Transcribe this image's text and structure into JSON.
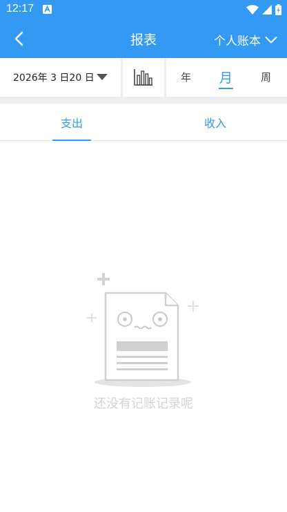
{
  "status_bar": {
    "time": "12:17"
  },
  "header": {
    "title": "报表",
    "account_selector": "个人账本"
  },
  "filter": {
    "date": "2026年 3 日20 日",
    "periods": [
      "年",
      "月",
      "周"
    ],
    "active_period": "月"
  },
  "tabs": [
    {
      "label": "支出"
    },
    {
      "label": "收入"
    }
  ],
  "empty_state": {
    "message": "还没有记账记录呢"
  },
  "colors": {
    "primary": "#3399f3",
    "divider": "#eeeef2",
    "placeholder": "#d3d3d3"
  }
}
